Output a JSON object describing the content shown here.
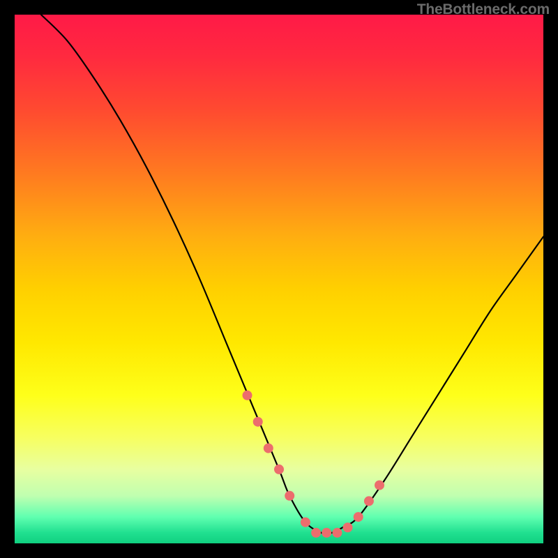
{
  "watermark": "TheBottleneck.com",
  "chart_data": {
    "type": "line",
    "title": "",
    "xlabel": "",
    "ylabel": "",
    "xlim": [
      0,
      100
    ],
    "ylim": [
      0,
      100
    ],
    "grid": false,
    "legend": false,
    "series": [
      {
        "name": "bottleneck-curve",
        "x": [
          5,
          10,
          15,
          20,
          25,
          30,
          35,
          40,
          45,
          50,
          52,
          55,
          58,
          60,
          62,
          65,
          70,
          75,
          80,
          85,
          90,
          95,
          100
        ],
        "y": [
          100,
          95,
          88,
          80,
          71,
          61,
          50,
          38,
          26,
          14,
          9,
          4,
          2,
          2,
          3,
          5,
          12,
          20,
          28,
          36,
          44,
          51,
          58
        ]
      }
    ],
    "markers": {
      "name": "highlight-points",
      "x": [
        44,
        46,
        48,
        50,
        52,
        55,
        57,
        59,
        61,
        63,
        65,
        67,
        69
      ],
      "y": [
        28,
        23,
        18,
        14,
        9,
        4,
        2,
        2,
        2,
        3,
        5,
        8,
        11
      ]
    },
    "annotations": []
  }
}
